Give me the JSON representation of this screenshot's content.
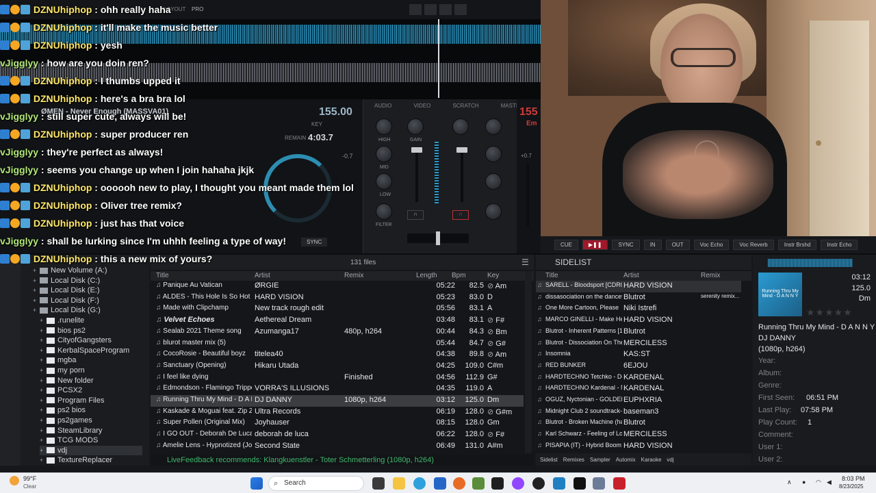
{
  "chat": [
    {
      "user": "DZNUhiphop",
      "text": "ohh really haha",
      "kind": "b"
    },
    {
      "user": "DZNUhiphop",
      "text": "it'll make the music better",
      "kind": "b"
    },
    {
      "user": "DZNUhiphop",
      "text": "yesh",
      "kind": "b"
    },
    {
      "user": "vJigglyy",
      "text": "how are you doin ren?",
      "kind": "a"
    },
    {
      "user": "DZNUhiphop",
      "text": "I thumbs upped it",
      "kind": "b"
    },
    {
      "user": "DZNUhiphop",
      "text": "here's a bra bra lol",
      "kind": "b"
    },
    {
      "user": "vJigglyy",
      "text": "still super cute, always will be!",
      "kind": "a"
    },
    {
      "user": "DZNUhiphop",
      "text": "super producer ren",
      "kind": "b"
    },
    {
      "user": "vJigglyy",
      "text": "they're perfect as always!",
      "kind": "a"
    },
    {
      "user": "vJigglyy",
      "text": "seems you change up when I join hahaha jkjk",
      "kind": "a"
    },
    {
      "user": "DZNUhiphop",
      "text": "oooooh new to play, I thought you meant made them lol",
      "kind": "b"
    },
    {
      "user": "DZNUhiphop",
      "text": "Oliver tree remix?",
      "kind": "b"
    },
    {
      "user": "DZNUhiphop",
      "text": "just has that voice",
      "kind": "b"
    },
    {
      "user": "vJigglyy",
      "text": "shall be lurking since I'm uhhh feeling a type of way!",
      "kind": "a"
    },
    {
      "user": "DZNUhiphop",
      "text": "this a new mix of yours?",
      "kind": "b"
    }
  ],
  "deck": {
    "left_track": "ØMEN - Never Enough (MASSVA01)",
    "left_bpm": "155.00",
    "left_remain": "4:03.7",
    "right_bpm": "155",
    "right_key": "Em",
    "layout_label": "LAYOUT",
    "layout_value": "PRO",
    "mixer_tabs": [
      "AUDIO",
      "VIDEO",
      "SCRATCH",
      "MASTER"
    ],
    "knob_labels": [
      "HIGH",
      "MID",
      "LOW",
      "FILTER",
      "GAIN"
    ],
    "pitch": "+0.7",
    "sync": "SYNC",
    "key_label": "KEY",
    "remain_label": "REMAIN",
    "left_pitch": "-0.7"
  },
  "transport": {
    "cue": "CUE",
    "sync": "SYNC",
    "in": "IN",
    "out": "OUT",
    "fx": [
      "Voc Echo",
      "Voc Reverb",
      "Instr Brshd",
      "Instr Echo"
    ]
  },
  "folders": [
    {
      "name": "New Volume (A:)",
      "type": "disk",
      "indent": 1
    },
    {
      "name": "Local Disk (C:)",
      "type": "disk",
      "indent": 1
    },
    {
      "name": "Local Disk (E:)",
      "type": "disk",
      "indent": 1
    },
    {
      "name": "Local Disk (F:)",
      "type": "disk",
      "indent": 1
    },
    {
      "name": "Local Disk (G:)",
      "type": "disk",
      "indent": 1
    },
    {
      "name": ".runelite",
      "type": "folder",
      "indent": 2
    },
    {
      "name": "bios ps2",
      "type": "folder",
      "indent": 2
    },
    {
      "name": "CityofGangsters",
      "type": "folder",
      "indent": 2
    },
    {
      "name": "KerbalSpaceProgram",
      "type": "folder",
      "indent": 2
    },
    {
      "name": "mgba",
      "type": "folder",
      "indent": 2
    },
    {
      "name": "my porn",
      "type": "folder",
      "indent": 2
    },
    {
      "name": "New folder",
      "type": "folder",
      "indent": 2
    },
    {
      "name": "PCSX2",
      "type": "folder",
      "indent": 2
    },
    {
      "name": "Program Files",
      "type": "folder",
      "indent": 2
    },
    {
      "name": "ps2 bios",
      "type": "folder",
      "indent": 2
    },
    {
      "name": "ps2games",
      "type": "folder",
      "indent": 2
    },
    {
      "name": "SteamLibrary",
      "type": "folder",
      "indent": 2
    },
    {
      "name": "TCG MODS",
      "type": "folder",
      "indent": 2
    },
    {
      "name": "vdj",
      "type": "folder",
      "indent": 2,
      "sel": true
    },
    {
      "name": "TextureReplacer",
      "type": "folder",
      "indent": 2
    }
  ],
  "browser": {
    "file_count": "131 files",
    "columns": {
      "title": "Title",
      "artist": "Artist",
      "remix": "Remix",
      "length": "Length",
      "bpm": "Bpm",
      "key": "Key"
    },
    "rows": [
      {
        "title": "Panique Au Vatican",
        "artist": "ØRGIE",
        "remix": "",
        "length": "05:22",
        "bpm": "82.5",
        "key": "Am",
        "keyicon": true
      },
      {
        "title": "ALDES - This Hole Is So Hot [DK0...",
        "artist": "HARD VISION",
        "remix": "",
        "length": "05:23",
        "bpm": "83.0",
        "key": "D"
      },
      {
        "title": "Made with Clipchamp",
        "artist": "New track rough edit",
        "remix": "",
        "length": "05:56",
        "bpm": "83.1",
        "key": "A"
      },
      {
        "title": "Velvet Echoes",
        "artist": "Aethereal Dream",
        "remix": "",
        "length": "03:48",
        "bpm": "83.1",
        "key": "F#",
        "keyicon": true,
        "bold": true
      },
      {
        "title": "Sealab 2021 Theme song",
        "artist": "Azumanga17",
        "remix": "480p, h264",
        "length": "00:44",
        "bpm": "84.3",
        "key": "Bm",
        "keyicon": true
      },
      {
        "title": "blurot master mix (5)",
        "artist": "",
        "remix": "",
        "length": "05:44",
        "bpm": "84.7",
        "key": "G#",
        "keyicon": true
      },
      {
        "title": "CocoRosie - Beautiful boyz",
        "artist": "titelea40",
        "remix": "",
        "length": "04:38",
        "bpm": "89.8",
        "key": "Am",
        "keyicon": true
      },
      {
        "title": "Sanctuary (Opening)",
        "artist": "Hikaru Utada",
        "remix": "",
        "length": "04:25",
        "bpm": "109.0",
        "key": "C#m"
      },
      {
        "title": "I feel like dying",
        "artist": "",
        "remix": "Finished",
        "length": "04:56",
        "bpm": "112.9",
        "key": "G#"
      },
      {
        "title": "Edmondson - Flamingo Tripper",
        "artist": "VORRA'S ILLUSIONS",
        "remix": "",
        "length": "04:35",
        "bpm": "119.0",
        "key": "A"
      },
      {
        "title": "Running Thru My Mind - D A N N Y",
        "artist": "DJ DANNY",
        "remix": "1080p, h264",
        "length": "03:12",
        "bpm": "125.0",
        "key": "Dm",
        "hl": true
      },
      {
        "title": "Kaskade & Moguai feat. Zip Zip Thr...",
        "artist": "Ultra Records",
        "remix": "",
        "length": "06:19",
        "bpm": "128.0",
        "key": "G#m",
        "keyicon": true
      },
      {
        "title": "Super Pollen (Original Mix)",
        "artist": "Joyhauser",
        "remix": "",
        "length": "08:15",
        "bpm": "128.0",
        "key": "Gm"
      },
      {
        "title": "I GO OUT - Deborah De Luca (Re...",
        "artist": "deborah de luca",
        "remix": "",
        "length": "06:22",
        "bpm": "128.0",
        "key": "F#",
        "keyicon": true
      },
      {
        "title": "Amelie Lens - Hypnotized (Joyhaus...",
        "artist": "Second State",
        "remix": "",
        "length": "06:49",
        "bpm": "131.0",
        "key": "A#m"
      }
    ],
    "recommend": "LiveFeedback recommends: Klangkuenstler - Toter Schmetterling (1080p, h264)"
  },
  "sidelist": {
    "title": "SIDELIST",
    "columns": {
      "title": "Title",
      "artist": "Artist",
      "remix": "Remix"
    },
    "rows": [
      {
        "title": "SARELL - Bloodsport [CDR001]",
        "artist": "HARD VISION",
        "remix": ""
      },
      {
        "title": "dissasociation on the dancefloor",
        "artist": "Blutrot",
        "remix": "serenity remix..."
      },
      {
        "title": "One More Cartoon, Please",
        "artist": "Niki Istrefi",
        "remix": ""
      },
      {
        "title": "MARCO GINELLI - Make Her...",
        "artist": "HARD VISION",
        "remix": ""
      },
      {
        "title": "Blutrot - Inherent Patterns [15...",
        "artist": "Blutrot",
        "remix": ""
      },
      {
        "title": "Blutrot - Dissociation On The...",
        "artist": "MERCILESS",
        "remix": ""
      },
      {
        "title": "Insomnia",
        "artist": "KAS:ST",
        "remix": ""
      },
      {
        "title": "RED BUNKER",
        "artist": "6EJOU",
        "remix": ""
      },
      {
        "title": "HARDTECHNO Tetchko - De...",
        "artist": "KARDENAL",
        "remix": ""
      },
      {
        "title": "HARDTECHNO Kardenal - N...",
        "artist": "KARDENAL",
        "remix": ""
      },
      {
        "title": "OGUZ, Nyctonian - GOLDEN...",
        "artist": "EUPHXRIA",
        "remix": ""
      },
      {
        "title": "Midnight Club 2 soundtrack-S...",
        "artist": "baseman3",
        "remix": ""
      },
      {
        "title": "Blutrot - Broken Machine (har...",
        "artist": "Blutrot",
        "remix": ""
      },
      {
        "title": "Karl Schwarz - Feeling of Love",
        "artist": "MERCILESS",
        "remix": ""
      },
      {
        "title": "PISAPIA (IT) - Hybrid Boom [...",
        "artist": "HARD VISION",
        "remix": ""
      }
    ],
    "tabs": [
      "Sidelist",
      "Remixes",
      "Sampler",
      "Automix",
      "Karaoke",
      "vdj"
    ]
  },
  "info": {
    "art_text": "Running Thru My Mind - D A N N Y",
    "time": "03:12",
    "bpm": "125.0",
    "key": "Dm",
    "title": "Running Thru My Mind - D A N N Y",
    "artist": "DJ DANNY",
    "format": "(1080p, h264)",
    "year_label": "Year:",
    "album_label": "Album:",
    "genre_label": "Genre:",
    "first_seen_label": "First Seen:",
    "first_seen": "06:51 PM",
    "last_play_label": "Last Play:",
    "last_play": "07:58 PM",
    "play_count_label": "Play Count:",
    "play_count": "1",
    "comment_label": "Comment:",
    "user1_label": "User 1:",
    "user2_label": "User 2:"
  },
  "taskbar": {
    "weather_temp": "99°F",
    "weather_desc": "Clear",
    "search": "Search",
    "time": "8:03 PM",
    "date": "8/23/2025"
  }
}
